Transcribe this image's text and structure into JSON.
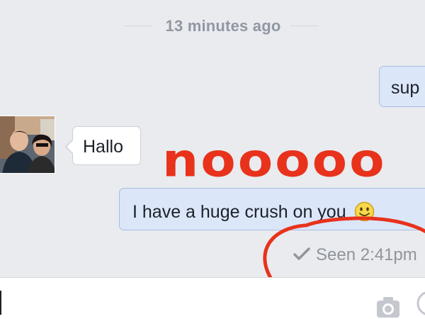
{
  "timestamp_divider": "13 minutes ago",
  "messages": [
    {
      "direction": "outgoing",
      "text": "sup"
    },
    {
      "direction": "incoming",
      "text": "Hallo"
    },
    {
      "direction": "outgoing",
      "text": "I have a huge crush on you",
      "emoji": "smiley-emoji"
    }
  ],
  "seen_receipt": {
    "label": "Seen 2:41pm",
    "icon": "check-icon"
  },
  "annotation": {
    "text": "nooooo",
    "color": "#e8321c"
  },
  "composer": {
    "icons": [
      "camera-icon",
      "sticker-icon"
    ]
  },
  "colors": {
    "outgoing_bubble": "#dbe6f9",
    "incoming_bubble": "#ffffff",
    "background": "#e9ebee",
    "meta_text": "#90949c"
  }
}
